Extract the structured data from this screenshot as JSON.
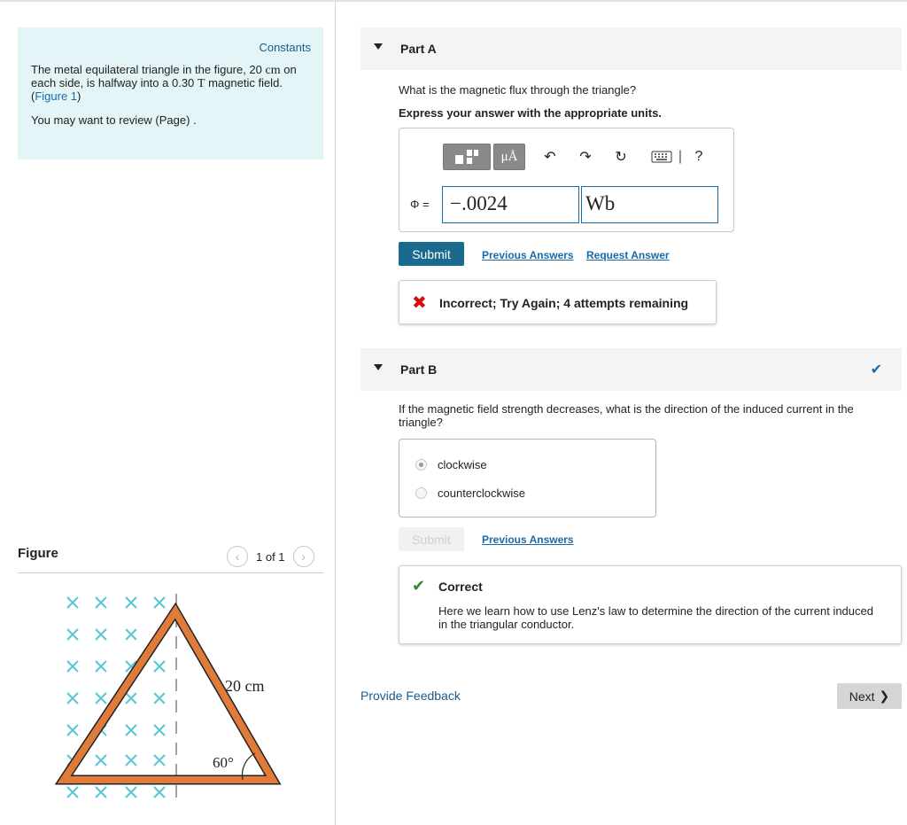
{
  "left_panel": {
    "constants_label": "Constants",
    "problem_intro": "The metal equilateral triangle in the figure, 20",
    "problem_unit_cm": "cm",
    "problem_mid": "on each side, is halfway into a 0.30",
    "problem_unit_T": "T",
    "problem_end": "magnetic field.",
    "figure_link": "Figure 1",
    "review_text": "You may want to review (Page) ."
  },
  "figure": {
    "title": "Figure",
    "prev_icon": "chevron-left-icon",
    "next_icon": "chevron-right-icon",
    "count": "1 of 1",
    "side_label": "20 cm",
    "angle_label": "60°"
  },
  "part_a": {
    "title": "Part A",
    "question": "What is the magnetic flux through the triangle?",
    "instruction": "Express your answer with the appropriate units.",
    "toolbar": {
      "template_icon": "template-icon",
      "units_label": "μÅ",
      "undo_icon": "undo-icon",
      "redo_icon": "redo-icon",
      "reset_icon": "reset-icon",
      "keyboard_icon": "keyboard-icon",
      "help_label": "?"
    },
    "phi_label": "Φ =",
    "value": "−.0024",
    "unit": "Wb",
    "submit_label": "Submit",
    "previous_answers": "Previous Answers",
    "request_answer": "Request Answer",
    "feedback": "Incorrect; Try Again; 4 attempts remaining"
  },
  "part_b": {
    "title": "Part B",
    "question": "If the magnetic field strength decreases, what is the direction of the induced current in the triangle?",
    "options": [
      "clockwise",
      "counterclockwise"
    ],
    "selected": "clockwise",
    "submit_label": "Submit",
    "previous_answers": "Previous Answers",
    "correct_title": "Correct",
    "correct_message": "Here we learn how to use Lenz's law to determine the direction of the current induced in the triangular conductor."
  },
  "footer": {
    "provide_feedback": "Provide Feedback",
    "next_label": "Next",
    "next_icon": "chevron-right-icon"
  },
  "colors": {
    "info_bg": "#e3f5f7",
    "link": "#1a6aa8",
    "submit_bg": "#1a6a8e",
    "incorrect": "#d10f0f",
    "correct": "#2e8b2e",
    "triangle_fill": "#e07b3a",
    "field_x": "#5fc8d6"
  }
}
